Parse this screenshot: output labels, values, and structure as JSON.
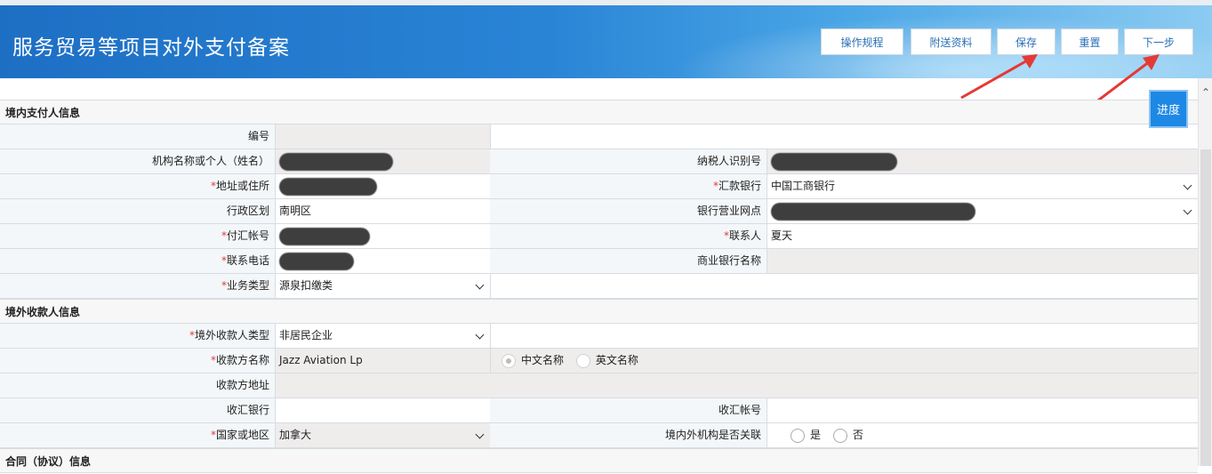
{
  "header": {
    "title": "服务贸易等项目对外支付备案",
    "buttons": {
      "rules": "操作规程",
      "attach": "附送资料",
      "save": "保存",
      "reset": "重置",
      "next": "下一步"
    }
  },
  "progress_label": "进度",
  "domestic": {
    "section_title": "境内支付人信息",
    "number_label": "编号",
    "number_value": "",
    "org_label": "机构名称或个人（姓名）",
    "tax_label": "纳税人识别号",
    "address_label": "地址或住所",
    "remit_bank_label": "汇款银行",
    "remit_bank_value": "中国工商银行",
    "region_label": "行政区划",
    "region_value": "南明区",
    "branch_label": "银行营业网点",
    "account_label": "付汇帐号",
    "contact_label": "联系人",
    "contact_value": "夏天",
    "phone_label": "联系电话",
    "commercial_bank_label": "商业银行名称",
    "commercial_bank_value": "",
    "biz_type_label": "业务类型",
    "biz_type_value": "源泉扣缴类"
  },
  "overseas": {
    "section_title": "境外收款人信息",
    "payee_type_label": "境外收款人类型",
    "payee_type_value": "非居民企业",
    "payee_name_label": "收款方名称",
    "payee_name_value": "Jazz Aviation Lp",
    "name_cn_option": "中文名称",
    "name_en_option": "英文名称",
    "payee_addr_label": "收款方地址",
    "payee_addr_value": "",
    "recv_bank_label": "收汇银行",
    "recv_bank_value": "",
    "recv_account_label": "收汇帐号",
    "recv_account_value": "",
    "country_label": "国家或地区",
    "country_value": "加拿大",
    "related_label": "境内外机构是否关联",
    "yes_option": "是",
    "no_option": "否"
  },
  "contract": {
    "section_title": "合同（协议）信息"
  },
  "colors": {
    "header_blue": "#1d6fc4",
    "required_star": "#e23b3b",
    "annotation_arrow": "#e53935"
  }
}
